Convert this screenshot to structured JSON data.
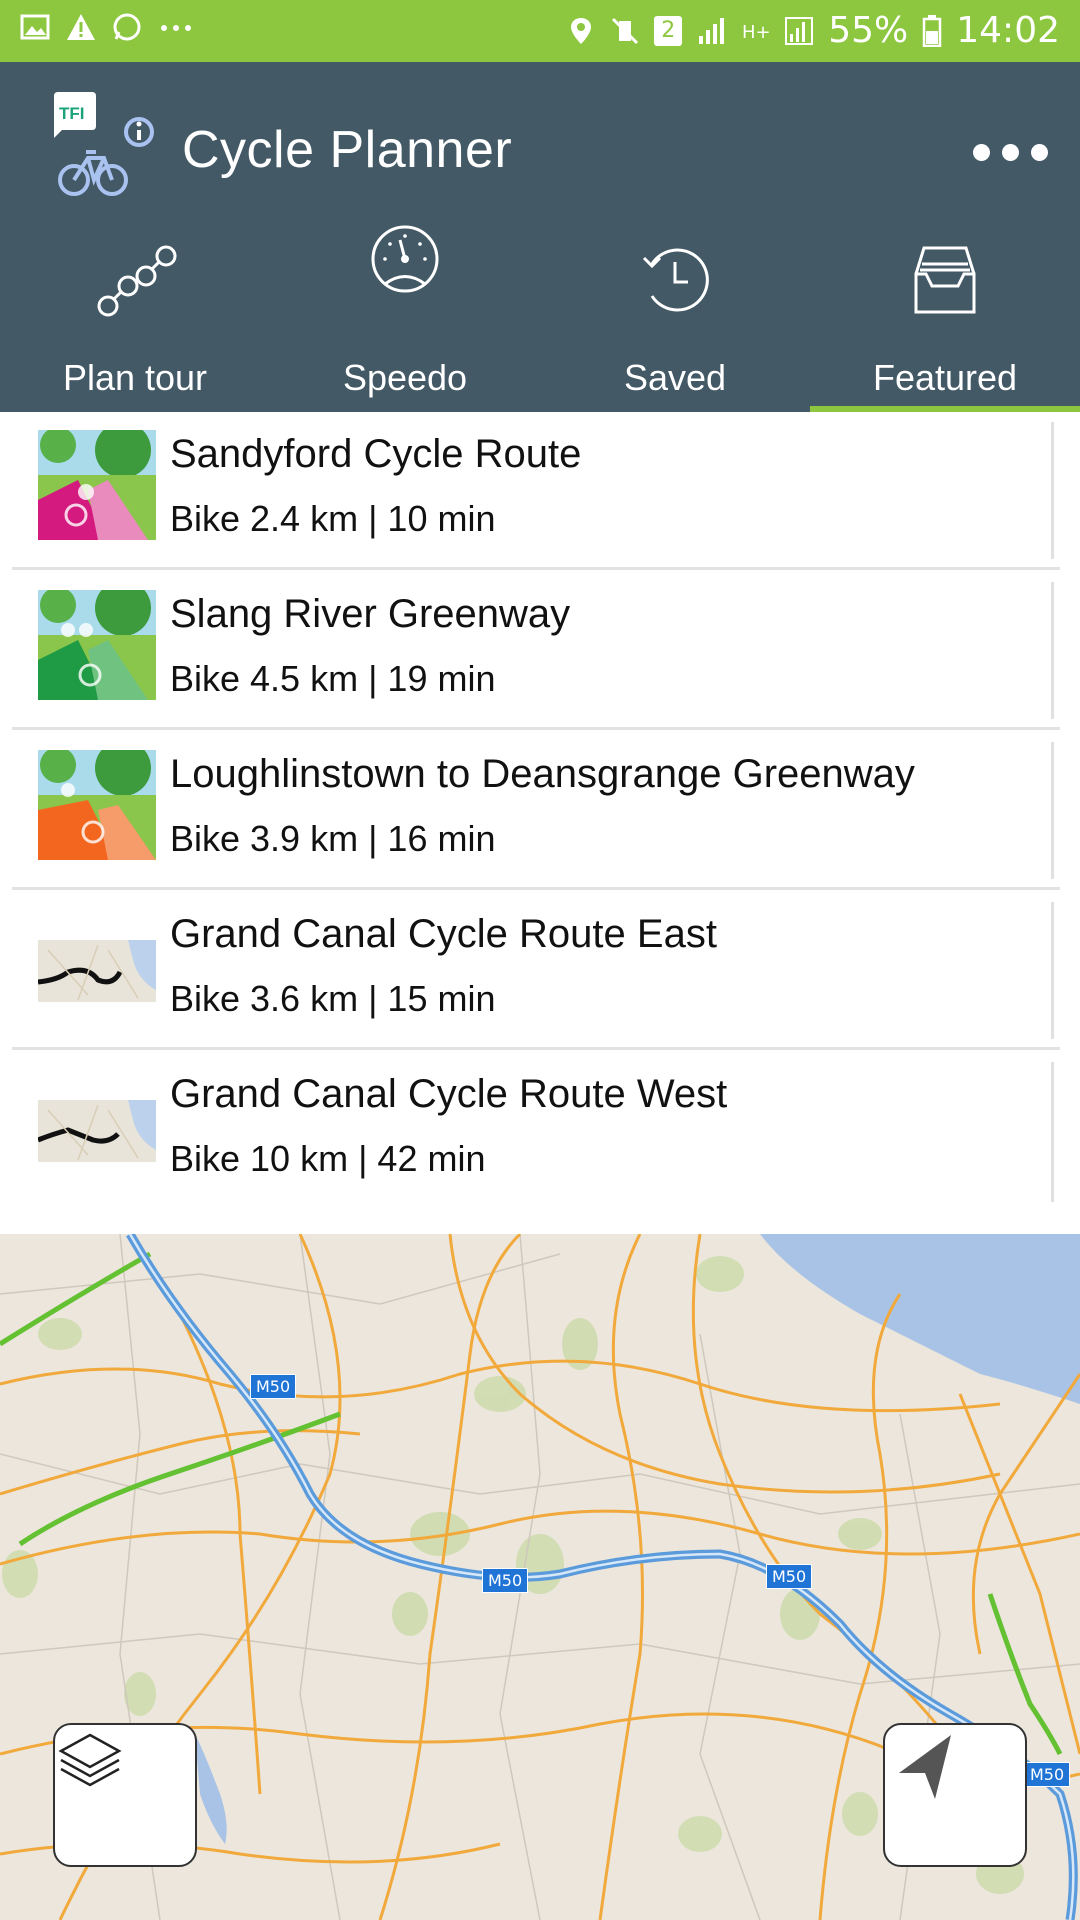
{
  "status_bar": {
    "battery": "55%",
    "time": "14:02",
    "notification_count": "2"
  },
  "header": {
    "app_title": "Cycle Planner",
    "logo_badge": "TFI"
  },
  "tabs": [
    {
      "label": "Plan tour",
      "icon": "route-icon",
      "active": false
    },
    {
      "label": "Speedo",
      "icon": "speedometer-icon",
      "active": false
    },
    {
      "label": "Saved",
      "icon": "history-icon",
      "active": false
    },
    {
      "label": "Featured",
      "icon": "inbox-tray-icon",
      "active": true
    }
  ],
  "routes": [
    {
      "title": "Sandyford Cycle Route",
      "subtitle": "Bike 2.4 km | 10 min",
      "thumb_color": "#d4197f"
    },
    {
      "title": "Slang River Greenway",
      "subtitle": "Bike 4.5 km | 19 min",
      "thumb_color": "#1f9a45"
    },
    {
      "title": "Loughlinstown to Deansgrange Greenway",
      "subtitle": "Bike 3.9 km | 16 min",
      "thumb_color": "#f2661f"
    },
    {
      "title": "Grand Canal Cycle Route East",
      "subtitle": "Bike 3.6 km | 15 min",
      "thumb_color": "map"
    },
    {
      "title": "Grand Canal Cycle Route West",
      "subtitle": "Bike 10 km | 42 min",
      "thumb_color": "map"
    }
  ],
  "map": {
    "road_labels": [
      "M50",
      "M50",
      "M50",
      "M50"
    ],
    "buttons": {
      "layers": "layers-icon",
      "location": "navigation-arrow-icon"
    }
  },
  "colors": {
    "status_bar": "#8dc63f",
    "header": "#435966",
    "active_tab_underline": "#8dc63f",
    "map_background": "#ece6dc"
  }
}
